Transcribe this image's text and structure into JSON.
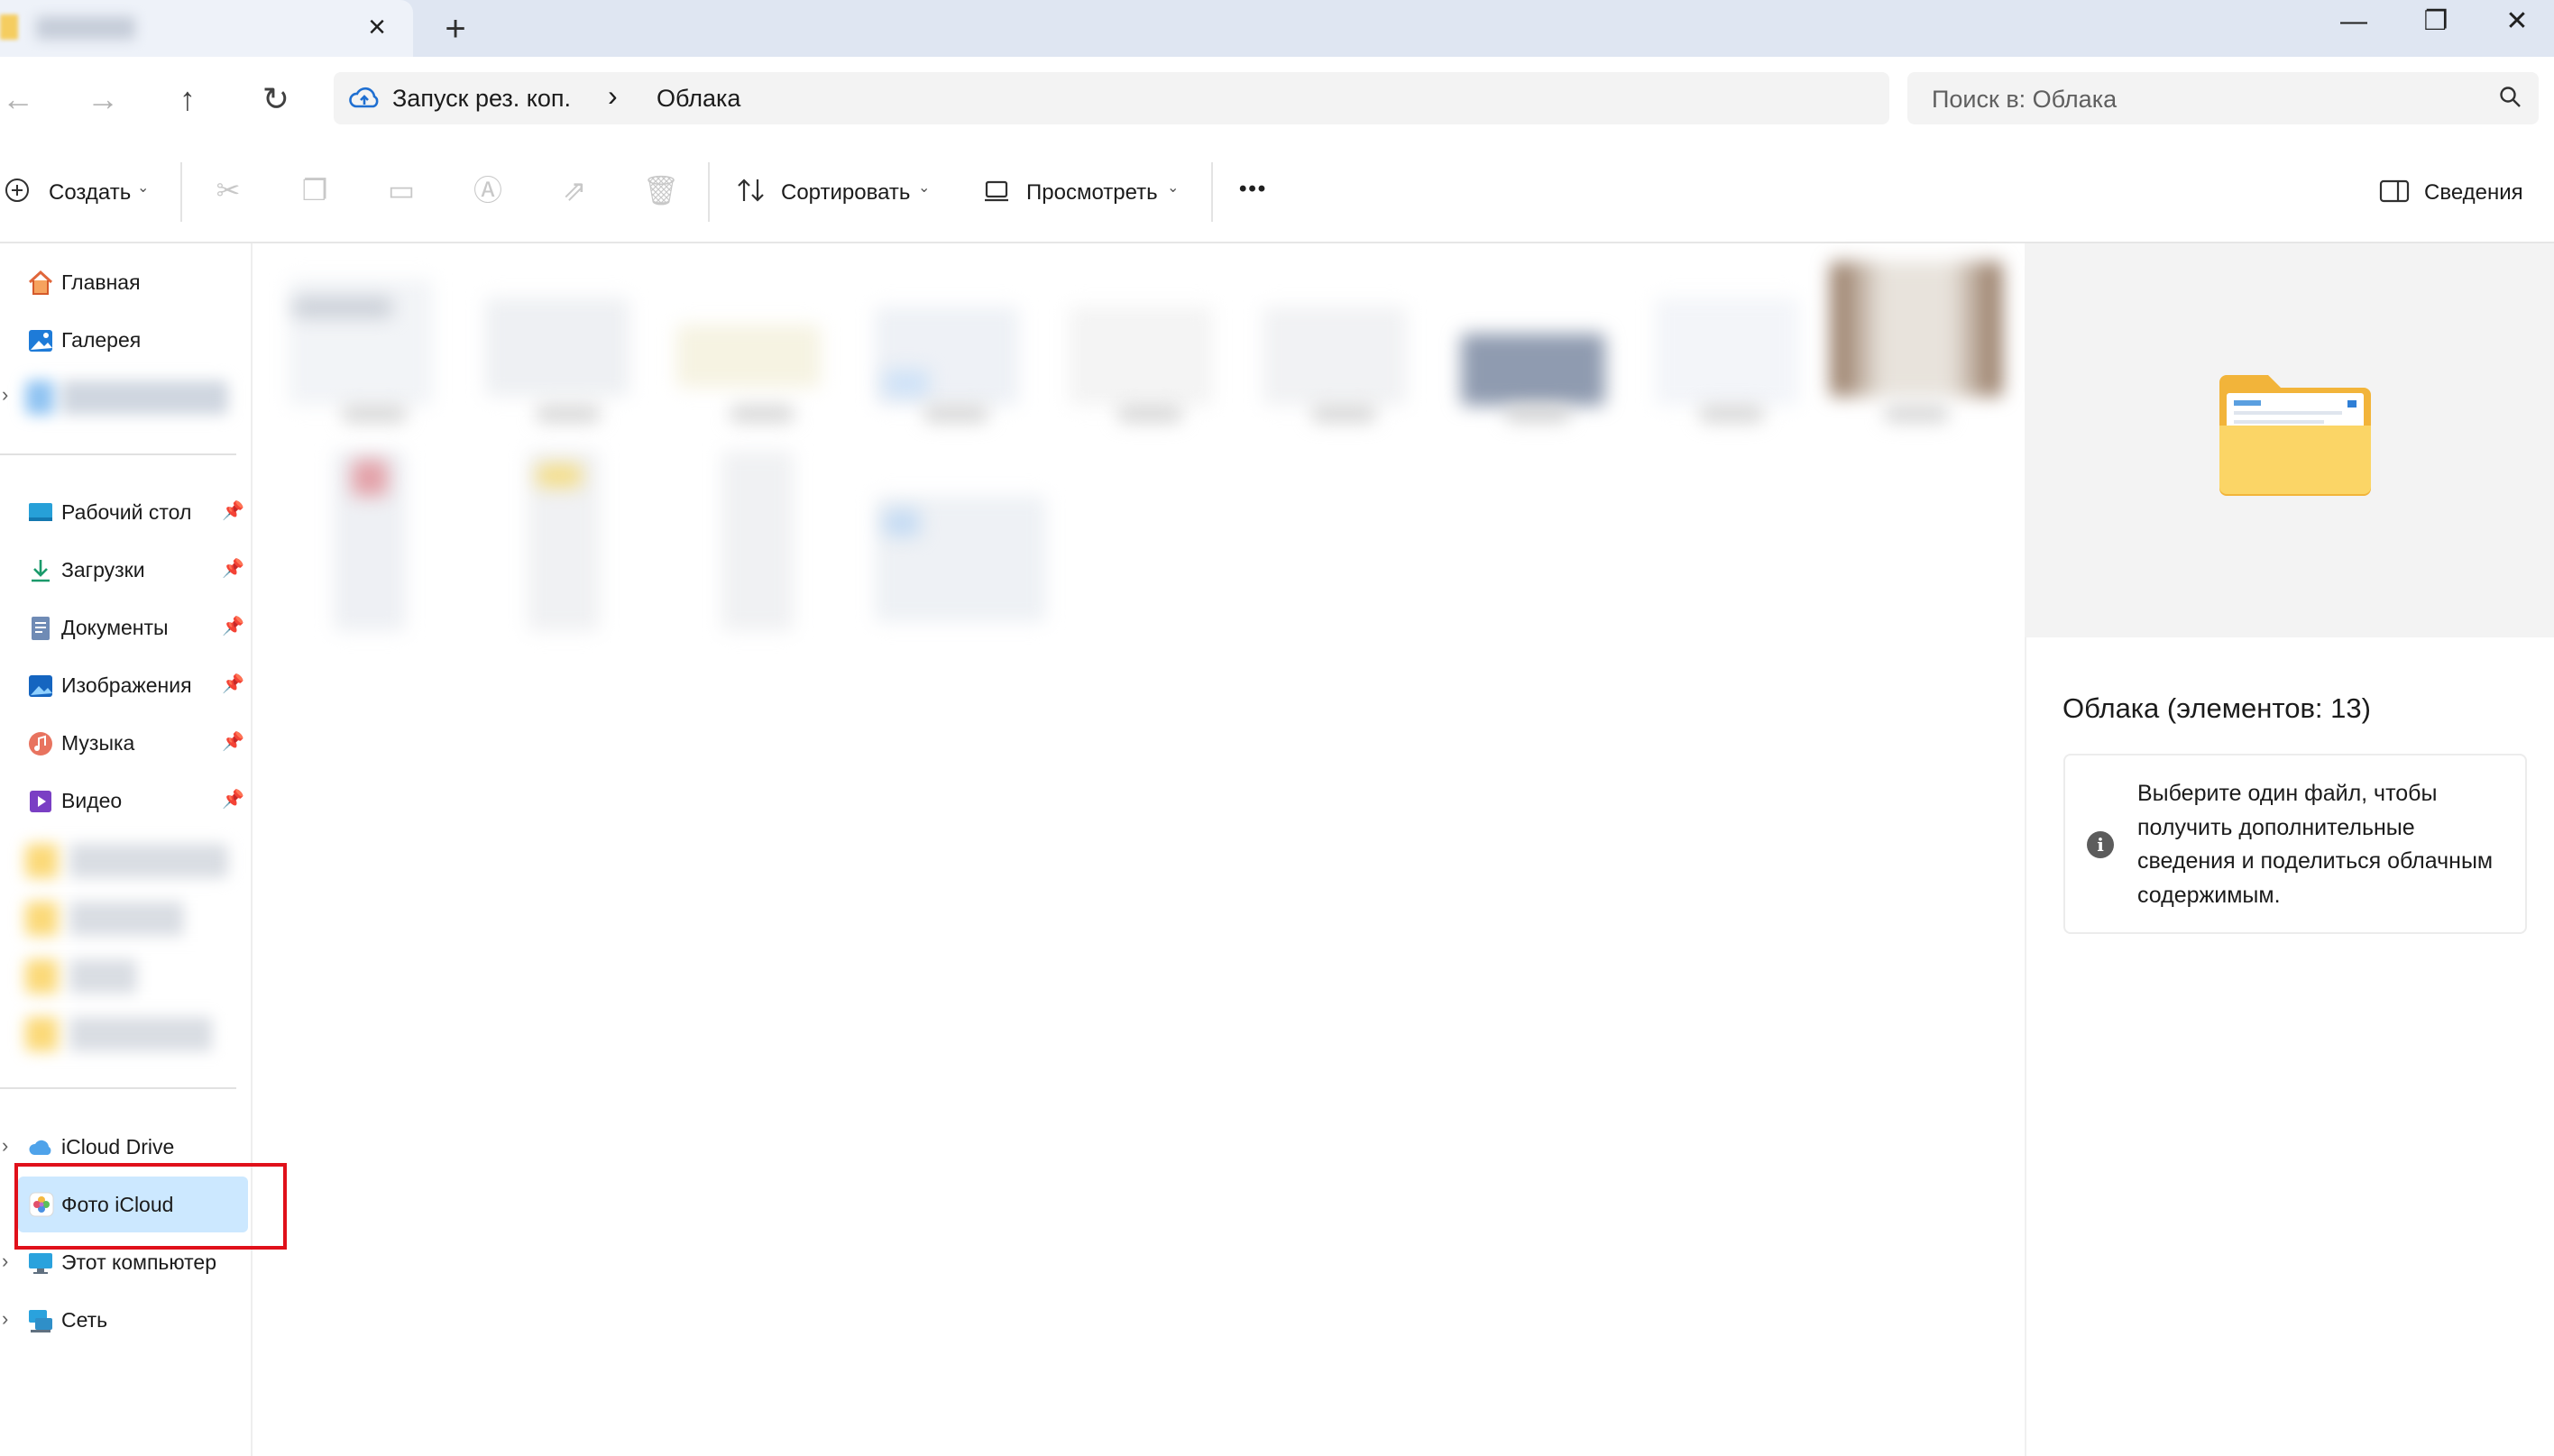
{
  "window": {
    "tab_close": "×",
    "new_tab": "+",
    "minimize": "—",
    "maximize": "❐",
    "close": "✕"
  },
  "nav": {
    "back": "←",
    "forward": "→",
    "up": "↑",
    "refresh": "↻"
  },
  "address": {
    "crumb1": "Запуск рез. коп.",
    "chevron": "›",
    "crumb2": "Облака"
  },
  "search": {
    "placeholder": "Поиск в: Облака"
  },
  "toolbar": {
    "create": "Создать",
    "sort": "Сортировать",
    "view": "Просмотреть",
    "more": "•••",
    "details": "Сведения"
  },
  "sidebar": {
    "home": "Главная",
    "gallery": "Галерея",
    "desktop": "Рабочий стол",
    "downloads": "Загрузки",
    "documents": "Документы",
    "pictures": "Изображения",
    "music": "Музыка",
    "videos": "Видео",
    "icloud_drive": "iCloud Drive",
    "icloud_photos": "Фото iCloud",
    "this_pc": "Этот компьютер",
    "network": "Сеть"
  },
  "details_pane": {
    "title": "Облака (элементов: 13)",
    "info": "Выберите один файл, чтобы получить дополнительные сведения и поделиться облачным содержимым.",
    "info_icon": "i"
  },
  "colors": {
    "selection": "#cce8ff",
    "highlight_box": "#e0101a",
    "folder": "#f5c64f",
    "accent": "#0067c0"
  }
}
